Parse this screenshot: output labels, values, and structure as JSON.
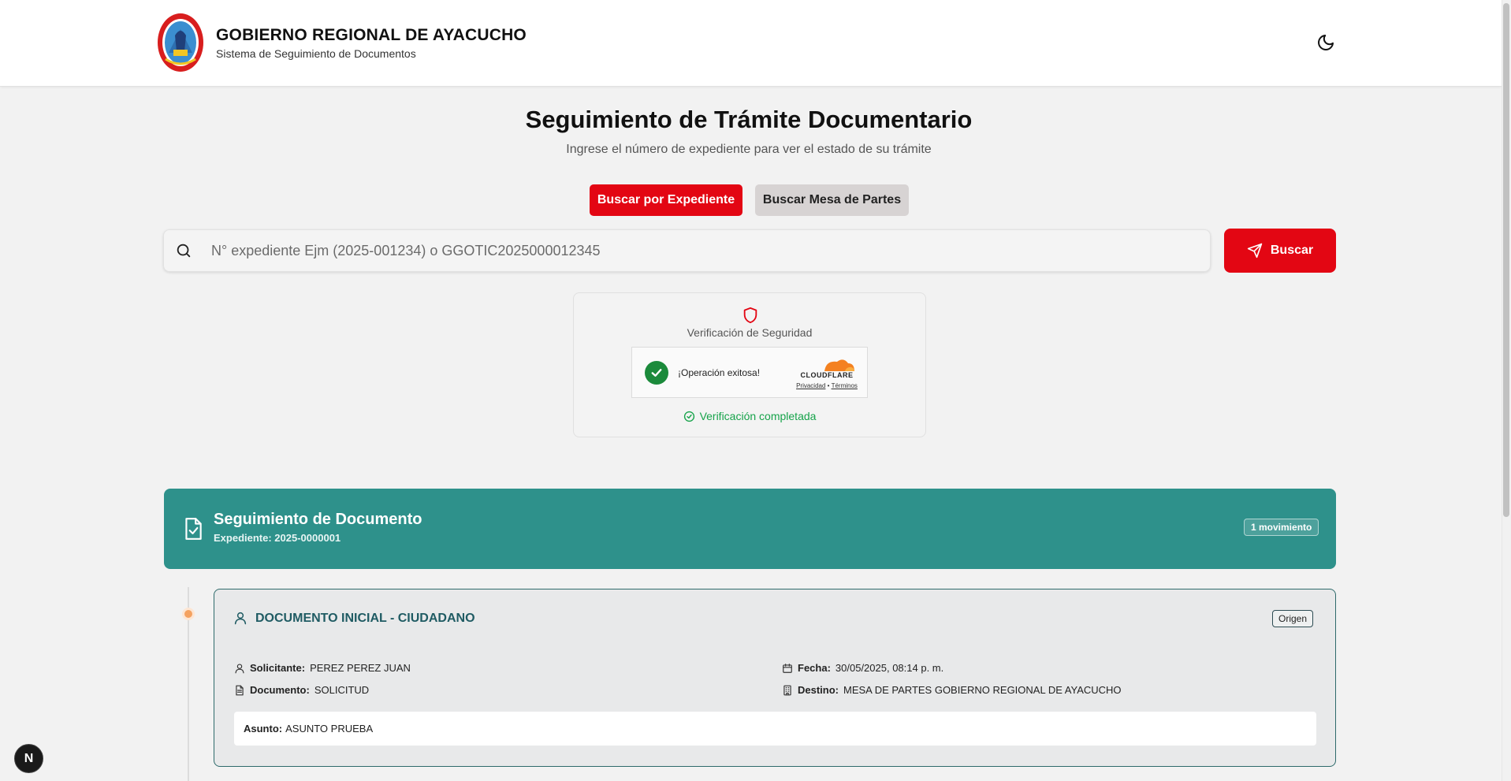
{
  "header": {
    "title": "GOBIERNO REGIONAL DE AYACUCHO",
    "subtitle": "Sistema de Seguimiento de Documentos"
  },
  "page": {
    "title": "Seguimiento de Trámite Documentario",
    "subtitle": "Ingrese el número de expediente para ver el estado de su trámite"
  },
  "tabs": {
    "expediente": "Buscar por Expediente",
    "mesa_partes": "Buscar Mesa de Partes"
  },
  "search": {
    "placeholder": "N° expediente Ejm (2025-001234) o GGOTIC2025000012345",
    "value": "",
    "button": "Buscar"
  },
  "verification": {
    "title": "Verificación de Seguridad",
    "widget_text": "¡Operación exitosa!",
    "brand": "CLOUDFLARE",
    "privacy": "Privacidad",
    "separator": "•",
    "terms": "Términos",
    "status": "Verificación completada"
  },
  "tracking": {
    "title": "Seguimiento de Documento",
    "expediente": "Expediente: 2025-0000001",
    "movements": "1 movimiento",
    "card": {
      "title": "DOCUMENTO INICIAL - CIUDADANO",
      "badge": "Origen",
      "solicitante_label": "Solicitante:",
      "solicitante": "PEREZ PEREZ JUAN",
      "documento_label": "Documento:",
      "documento": "SOLICITUD",
      "fecha_label": "Fecha:",
      "fecha": "30/05/2025, 08:14 p. m.",
      "destino_label": "Destino:",
      "destino": "MESA DE PARTES GOBIERNO REGIONAL DE AYACUCHO",
      "asunto_label": "Asunto:",
      "asunto": "ASUNTO PRUEBA"
    }
  },
  "dev_badge": "N",
  "colors": {
    "primary_red": "#e30613",
    "teal": "#2e918b",
    "success_green": "#16a34a"
  }
}
